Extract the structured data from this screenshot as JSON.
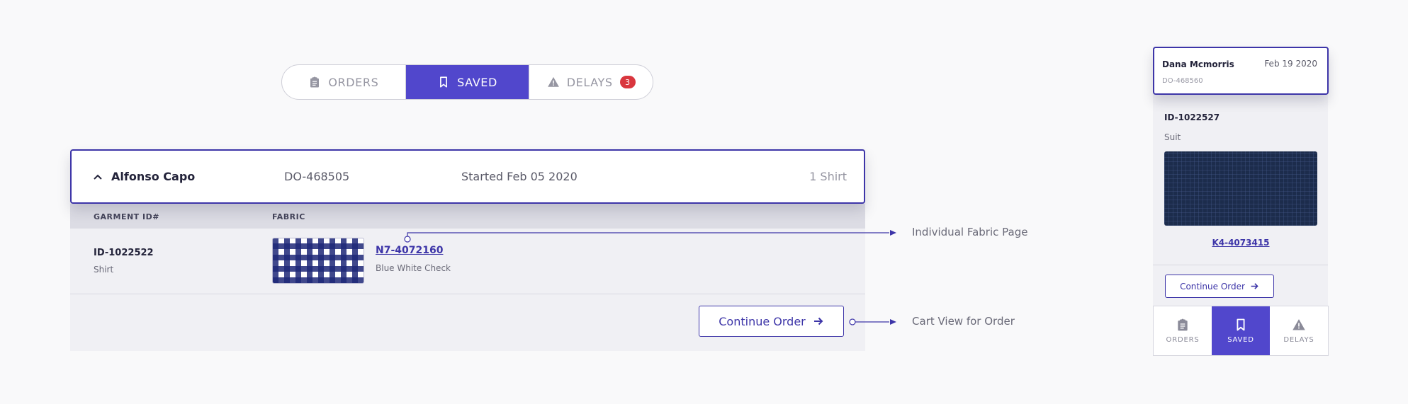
{
  "tabs": [
    {
      "label": "ORDERS",
      "icon": "clipboard-icon"
    },
    {
      "label": "SAVED",
      "icon": "bookmark-icon",
      "active": true
    },
    {
      "label": "DELAYS",
      "icon": "warning-icon",
      "badge": "3"
    }
  ],
  "order": {
    "customer": "Alfonso Capo",
    "order_id": "DO-468505",
    "started": "Started Feb 05 2020",
    "count": "1 Shirt",
    "columns": {
      "garment": "GARMENT ID#",
      "fabric": "FABRIC"
    },
    "garment": {
      "id": "ID-1022522",
      "type": "Shirt",
      "fabric_code": "N7-4072160",
      "fabric_name": "Blue White Check"
    },
    "continue_label": "Continue Order"
  },
  "annotations": {
    "fabric": "Individual Fabric Page",
    "cart": "Cart View for Order"
  },
  "mobile": {
    "customer": "Dana Mcmorris",
    "date": "Feb 19 2020",
    "order_id": "DO-468560",
    "garment_id": "ID-1022527",
    "garment_type": "Suit",
    "fabric_code": "K4-4073415",
    "continue_label": "Continue Order",
    "nav": [
      {
        "label": "ORDERS",
        "icon": "clipboard-icon"
      },
      {
        "label": "SAVED",
        "icon": "bookmark-icon",
        "active": true
      },
      {
        "label": "DELAYS",
        "icon": "warning-icon"
      }
    ]
  },
  "colors": {
    "accent": "#5147cc",
    "accent_dark": "#3d35a8",
    "badge": "#d9363e"
  }
}
